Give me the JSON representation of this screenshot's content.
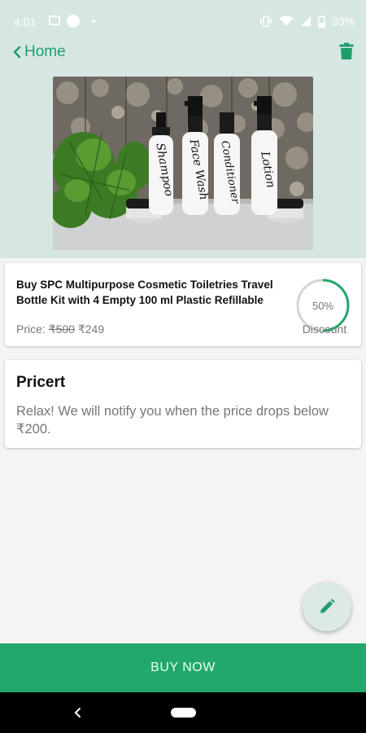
{
  "status_bar": {
    "time": "4:01",
    "battery": "33%"
  },
  "app_bar": {
    "back_label": "Home"
  },
  "product": {
    "title": "Buy SPC Multipurpose Cosmetic Toiletries Travel Bottle Kit with 4 Empty 100 ml Plastic Refillable",
    "price_label": "Price:",
    "old_price": "₹500",
    "new_price": "₹249",
    "discount_percent": 50,
    "discount_text": "50%",
    "discount_label": "Discount",
    "bottle_labels": [
      "Shampoo",
      "Face Wash",
      "Conditioner",
      "Lotion"
    ]
  },
  "alert": {
    "title": "Pricert",
    "message": "Relax! We will notify you when the price drops below ₹200."
  },
  "buy_button": {
    "label": "BUY NOW"
  },
  "colors": {
    "accent": "#22a86a",
    "header_bg": "#d6e6e3",
    "fab_bg": "#dde9e6"
  },
  "icons": [
    "back-chevron-icon",
    "trash-icon",
    "edit-pencil-icon",
    "nav-back-icon",
    "wifi-icon",
    "signal-icon",
    "battery-icon"
  ]
}
